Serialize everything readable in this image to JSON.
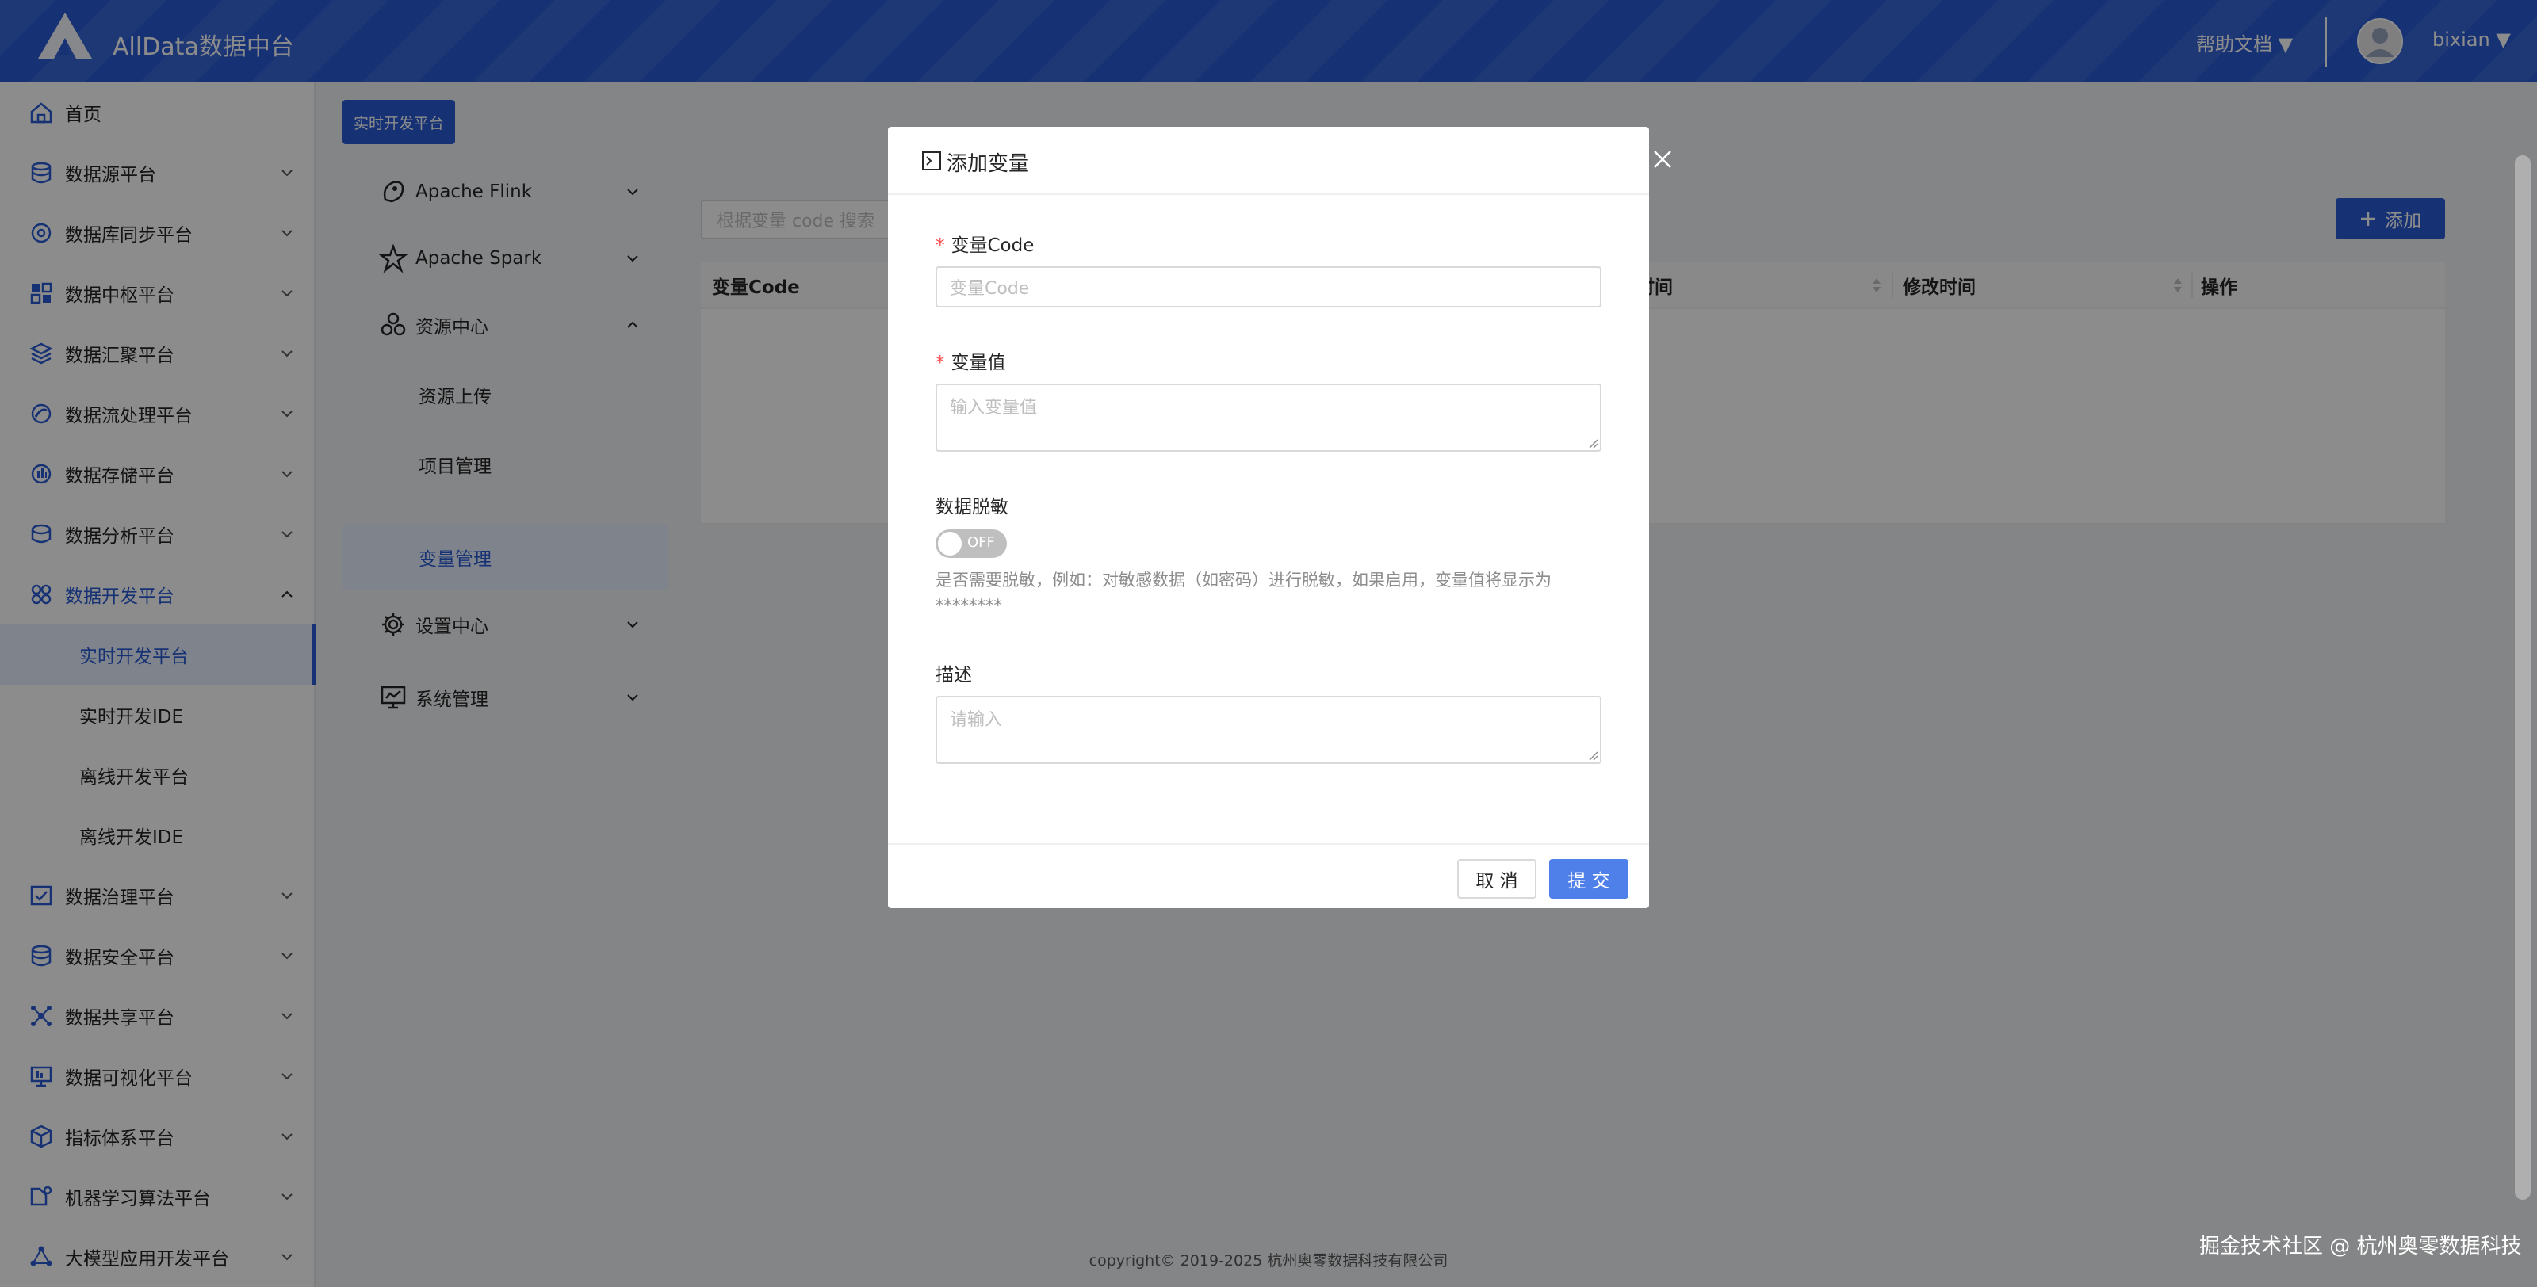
{
  "header": {
    "app_title": "AllData数据中台",
    "help_label": "帮助文档 ▼",
    "user_label": "bixian ▼"
  },
  "sidebar": {
    "items": [
      {
        "label": "首页",
        "icon": "home-icon"
      },
      {
        "label": "数据源平台",
        "icon": "database-icon"
      },
      {
        "label": "数据库同步平台",
        "icon": "sync-icon"
      },
      {
        "label": "数据中枢平台",
        "icon": "grid-icon"
      },
      {
        "label": "数据汇聚平台",
        "icon": "layers-icon"
      },
      {
        "label": "数据流处理平台",
        "icon": "stream-icon"
      },
      {
        "label": "数据存储平台",
        "icon": "storage-icon"
      },
      {
        "label": "数据分析平台",
        "icon": "analytics-icon"
      },
      {
        "label": "数据开发平台",
        "icon": "dev-icon"
      },
      {
        "label": "实时开发平台",
        "icon": ""
      },
      {
        "label": "实时开发IDE",
        "icon": ""
      },
      {
        "label": "离线开发平台",
        "icon": ""
      },
      {
        "label": "离线开发IDE",
        "icon": ""
      },
      {
        "label": "数据治理平台",
        "icon": "governance-icon"
      },
      {
        "label": "数据安全平台",
        "icon": "security-icon"
      },
      {
        "label": "数据共享平台",
        "icon": "share-icon"
      },
      {
        "label": "数据可视化平台",
        "icon": "monitor-icon"
      },
      {
        "label": "指标体系平台",
        "icon": "cube-icon"
      },
      {
        "label": "机器学习算法平台",
        "icon": "ml-icon"
      },
      {
        "label": "大模型应用开发平台",
        "icon": "model-icon"
      }
    ]
  },
  "subnav": {
    "tag_label": "实时开发平台",
    "items": [
      {
        "label": "Apache Flink",
        "icon": "flink-icon"
      },
      {
        "label": "Apache Spark",
        "icon": "spark-icon"
      },
      {
        "label": "资源中心",
        "icon": "resource-icon"
      },
      {
        "label": "资源上传",
        "icon": ""
      },
      {
        "label": "项目管理",
        "icon": ""
      },
      {
        "label": "变量管理",
        "icon": ""
      },
      {
        "label": "设置中心",
        "icon": "gear-icon"
      },
      {
        "label": "系统管理",
        "icon": "system-icon"
      }
    ]
  },
  "main": {
    "search_placeholder": "根据变量 code 搜索",
    "add_label": "添加",
    "columns": [
      "变量Code",
      "时间",
      "修改时间",
      "操作"
    ]
  },
  "modal": {
    "title": "添加变量",
    "code_label": "变量Code",
    "code_placeholder": "变量Code",
    "value_label": "变量值",
    "value_placeholder": "输入变量值",
    "mask_label": "数据脱敏",
    "toggle_text": "OFF",
    "toggle_on": false,
    "mask_hint": "是否需要脱敏，例如：对敏感数据（如密码）进行脱敏，如果启用，变量值将显示为********",
    "desc_label": "描述",
    "desc_placeholder": "请输入",
    "cancel_label": "取 消",
    "submit_label": "提 交"
  },
  "footer": {
    "copyright": "copyright© 2019-2025 杭州奥零数据科技有限公司",
    "watermark": "掘金技术社区 @ 杭州奥零数据科技"
  },
  "colors": {
    "primary": "#2a5cd4",
    "submit": "#4f7fe8",
    "required": "#ff4d4f"
  }
}
